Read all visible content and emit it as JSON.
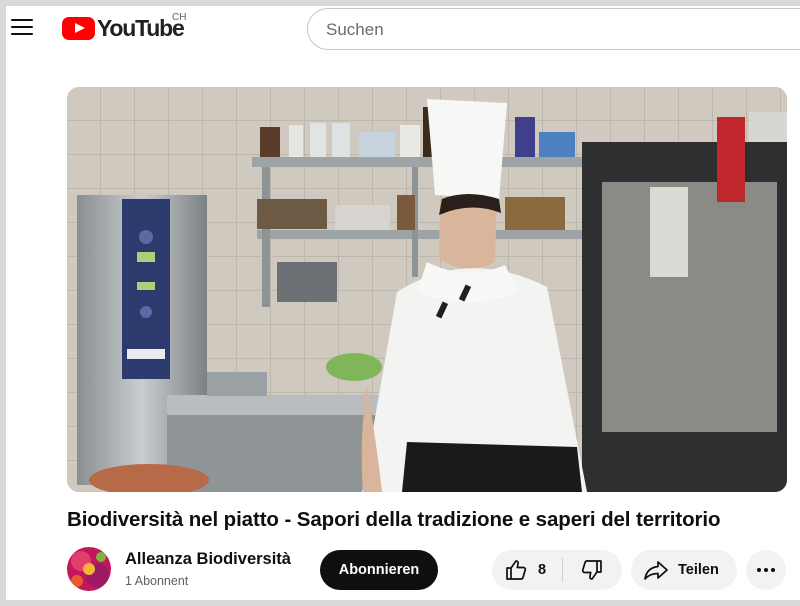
{
  "header": {
    "logo_text": "YouTube",
    "country_code": "CH",
    "search_placeholder": "Suchen"
  },
  "video": {
    "title": "Biodiversità nel piatto - Sapori della tradizione e saperi del territorio"
  },
  "channel": {
    "name": "Alleanza Biodiversità",
    "subscribers": "1 Abonnent",
    "subscribe_label": "Abonnieren"
  },
  "actions": {
    "like_count": "8",
    "share_label": "Teilen"
  },
  "colors": {
    "brand_red": "#ff0000",
    "subscribe_bg": "#0f0f0f",
    "pill_bg": "#f2f2f2"
  },
  "icons": [
    "menu-icon",
    "youtube-logo-icon",
    "like-icon",
    "dislike-icon",
    "share-icon",
    "more-icon"
  ]
}
